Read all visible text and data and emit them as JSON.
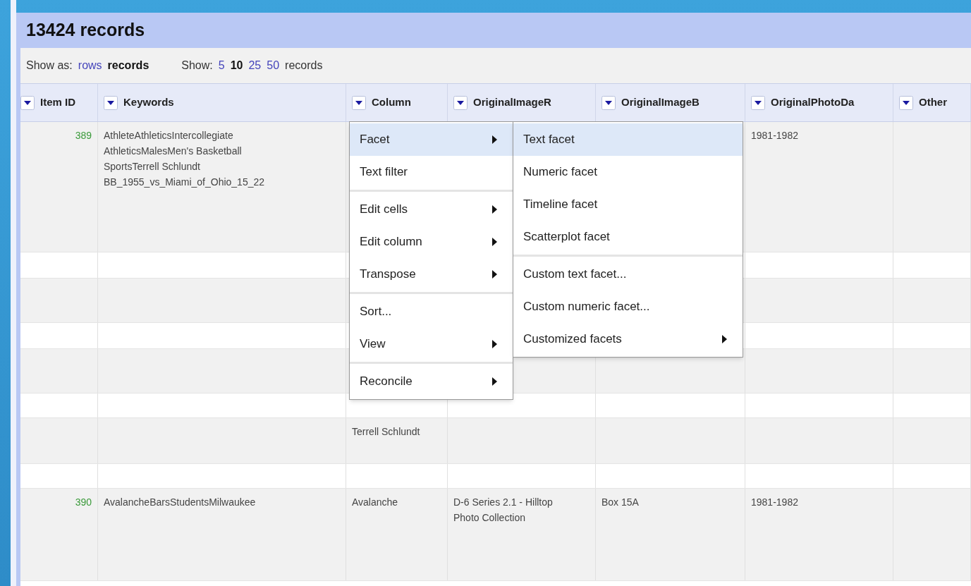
{
  "title": "13424 records",
  "show_as": {
    "label": "Show as:",
    "options": [
      {
        "label": "rows",
        "selected": false
      },
      {
        "label": "records",
        "selected": true
      }
    ]
  },
  "page_size": {
    "label": "Show:",
    "options": [
      {
        "label": "5",
        "selected": false
      },
      {
        "label": "10",
        "selected": true
      },
      {
        "label": "25",
        "selected": false
      },
      {
        "label": "50",
        "selected": false
      }
    ],
    "suffix": "records"
  },
  "table": {
    "columns": [
      {
        "label": "Item ID"
      },
      {
        "label": "Keywords"
      },
      {
        "label": "Column"
      },
      {
        "label": "OriginalImageR"
      },
      {
        "label": "OriginalImageB"
      },
      {
        "label": "OriginalPhotoDa"
      },
      {
        "label": "Other"
      }
    ],
    "rows": [
      {
        "cells": [
          "389",
          "AthleteAthleticsIntercollegiate AthleticsMalesMen's Basketball SportsTerrell Schlundt BB_1955_vs_Miami_of_Ohio_15_22",
          null,
          null,
          null,
          "1981-1982",
          null
        ]
      },
      {},
      {},
      {},
      {},
      {},
      {
        "cells": [
          null,
          null,
          "Terrell Schlundt",
          null,
          null,
          null,
          null
        ]
      },
      {},
      {
        "cells": [
          "390",
          "AvalancheBarsStudentsMilwaukee",
          "Avalanche",
          "D-6 Series 2.1 - Hilltop Photo Collection",
          "Box 15A",
          "1981-1982",
          null
        ]
      }
    ]
  },
  "menu": {
    "items": [
      {
        "kind": "item",
        "label": "Facet",
        "submenu": true,
        "selected": true
      },
      {
        "kind": "item",
        "label": "Text filter",
        "submenu": false,
        "selected": false
      },
      {
        "kind": "separator"
      },
      {
        "kind": "item",
        "label": "Edit cells",
        "submenu": true,
        "selected": false
      },
      {
        "kind": "item",
        "label": "Edit column",
        "submenu": true,
        "selected": false
      },
      {
        "kind": "item",
        "label": "Transpose",
        "submenu": true,
        "selected": false
      },
      {
        "kind": "separator"
      },
      {
        "kind": "item",
        "label": "Sort...",
        "submenu": false,
        "selected": false
      },
      {
        "kind": "item",
        "label": "View",
        "submenu": true,
        "selected": false
      },
      {
        "kind": "separator"
      },
      {
        "kind": "item",
        "label": "Reconcile",
        "submenu": true,
        "selected": false
      }
    ]
  },
  "submenu": {
    "items": [
      {
        "kind": "item",
        "label": "Text facet",
        "submenu": false,
        "selected": true
      },
      {
        "kind": "item",
        "label": "Numeric facet",
        "submenu": false,
        "selected": false
      },
      {
        "kind": "item",
        "label": "Timeline facet",
        "submenu": false,
        "selected": false
      },
      {
        "kind": "item",
        "label": "Scatterplot facet",
        "submenu": false,
        "selected": false
      },
      {
        "kind": "separator"
      },
      {
        "kind": "item",
        "label": "Custom text facet...",
        "submenu": false,
        "selected": false
      },
      {
        "kind": "item",
        "label": "Custom numeric facet...",
        "submenu": false,
        "selected": false
      },
      {
        "kind": "item",
        "label": "Customized facets",
        "submenu": true,
        "selected": false
      }
    ]
  }
}
